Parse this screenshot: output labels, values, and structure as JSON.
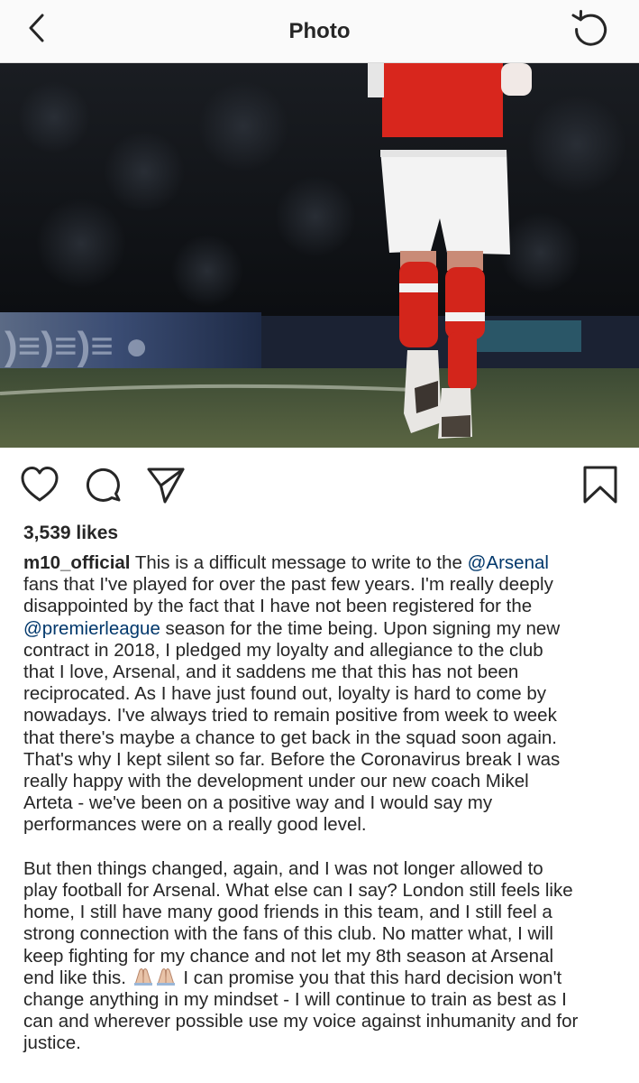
{
  "header": {
    "title": "Photo"
  },
  "post": {
    "likes": "3,539 likes",
    "username": "m10_official",
    "caption": {
      "l1": " This is a difficult message to write to the ",
      "m1": "@Arsenal",
      "l2": "fans that I've played for over the past few years. I'm really deeply",
      "l3": "disappointed by the fact that I have not been registered for the",
      "m2": "@premierleague",
      "l4": " season for the time being. Upon signing my new",
      "l5": "contract in 2018, I pledged my loyalty and allegiance to the club",
      "l6": "that I love, Arsenal, and it saddens me that this has not been",
      "l7": "reciprocated. As I have just found out, loyalty is hard to come by",
      "l8": "nowadays. I've always tried to remain positive from week to week",
      "l9": "that there's maybe a chance to get back in the squad soon again.",
      "l10": "That's why I kept silent so far. Before the Coronavirus break I was",
      "l11": "really happy with the development under our new coach Mikel",
      "l12": "Arteta - we've been on a positive way and I would say my",
      "l13": "performances were on a really good level.",
      "l14": "But then things changed, again, and I was not longer allowed to",
      "l15": "play football for Arsenal. What else can I say? London still feels like",
      "l16": "home, I still have many good friends in this team, and I still feel a",
      "l17": "strong connection with the fans of this club. No matter what, I will",
      "l18": "keep fighting for my chance and not let my 8th season at Arsenal",
      "l19a": "end like this. ",
      "l19b": " I can promise you that this hard decision won't",
      "l20": "change anything in my mindset - I will continue to train as best as I",
      "l21": "can and wherever possible use my voice against inhumanity and for",
      "l22": "justice."
    }
  },
  "colors": {
    "mention": "#00376b",
    "text": "#262626",
    "header_bg": "#fafafa"
  },
  "icons": [
    "back-chevron-icon",
    "refresh-icon",
    "heart-icon",
    "comment-icon",
    "share-icon",
    "bookmark-icon",
    "folded-hands-emoji-icon"
  ]
}
